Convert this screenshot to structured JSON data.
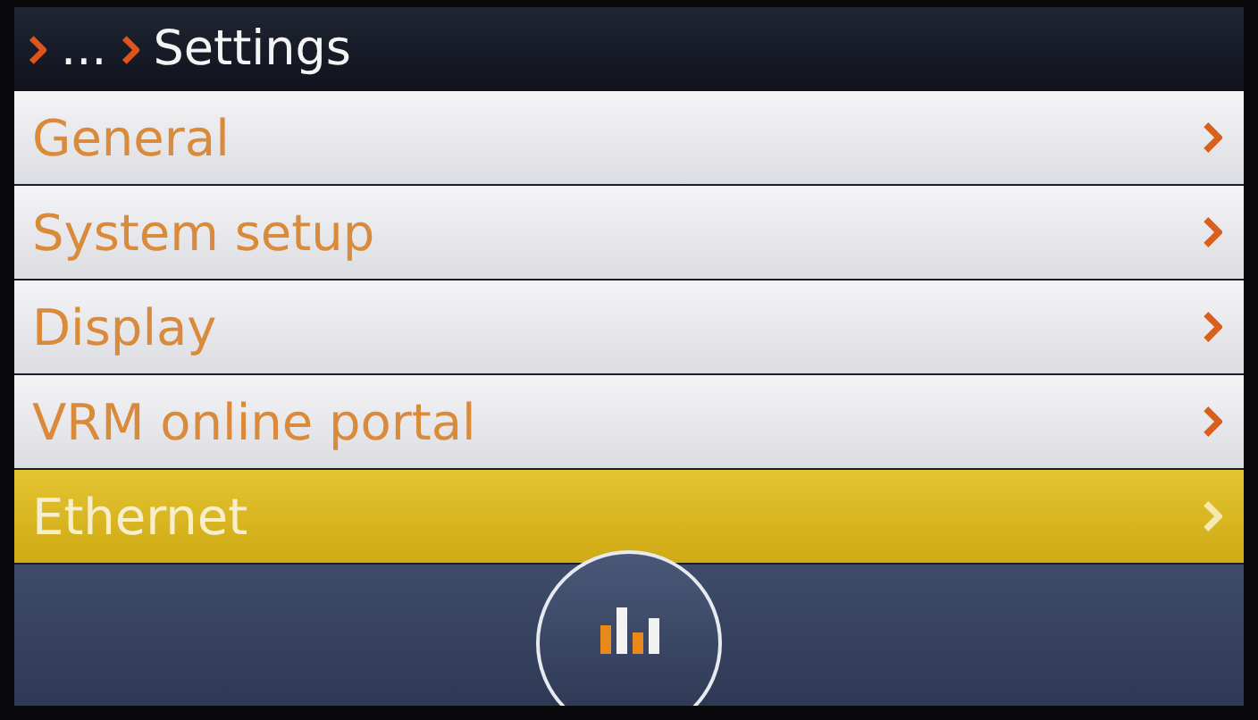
{
  "header": {
    "ellipsis": "...",
    "title": "Settings"
  },
  "items": [
    {
      "label": "General",
      "selected": false
    },
    {
      "label": "System setup",
      "selected": false
    },
    {
      "label": "Display",
      "selected": false
    },
    {
      "label": "VRM online portal",
      "selected": false
    },
    {
      "label": "Ethernet",
      "selected": true
    }
  ]
}
